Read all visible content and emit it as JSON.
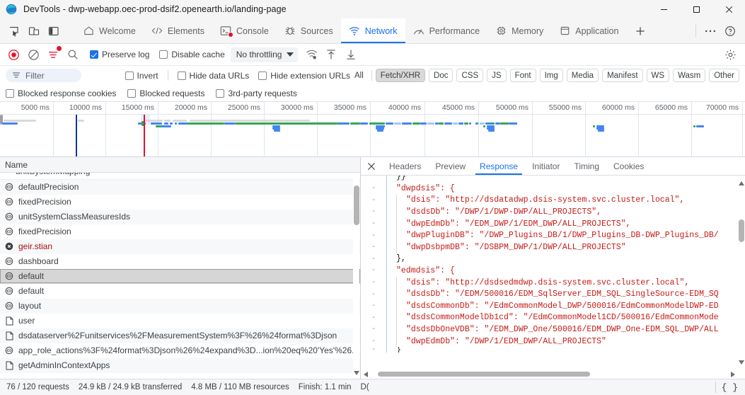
{
  "window": {
    "title": "DevTools - dwp-webapp.oec-prod-dsif2.openearth.io/landing-page",
    "minimize": "minimize-icon",
    "maximize": "maximize-icon",
    "close": "close-icon"
  },
  "tabstrip": {
    "left_icons": [
      {
        "name": "inspect-element-icon"
      },
      {
        "name": "device-toolbar-icon"
      },
      {
        "name": "dock-side-icon"
      }
    ],
    "tabs": [
      {
        "label": "Welcome",
        "icon": "home-icon",
        "active": false
      },
      {
        "label": "Elements",
        "icon": "code-brackets-icon",
        "active": false
      },
      {
        "label": "Console",
        "icon": "console-terminal-icon",
        "active": false,
        "badge": "error"
      },
      {
        "label": "Sources",
        "icon": "bug-icon",
        "active": false
      },
      {
        "label": "Network",
        "icon": "network-wifi-icon",
        "active": true
      },
      {
        "label": "Performance",
        "icon": "performance-gauge-icon",
        "active": false
      },
      {
        "label": "Memory",
        "icon": "memory-chip-icon",
        "active": false
      },
      {
        "label": "Application",
        "icon": "application-box-icon",
        "active": false
      }
    ],
    "add_tab": "+",
    "more_tools": "more-horizontal-icon",
    "help": "help-circle-icon"
  },
  "network_toolbar": {
    "record": "record-stop-icon",
    "clear": "clear-circle-slash-icon",
    "filter_toggle": "filter-lines-icon",
    "search": "search-icon",
    "preserve_log": {
      "label": "Preserve log",
      "checked": true
    },
    "disable_cache": {
      "label": "Disable cache",
      "checked": false
    },
    "throttling": {
      "value": "No throttling",
      "caret": "chevron-down-icon"
    },
    "network_conditions": "network-conditions-icon",
    "import_har": "upload-arrow-icon",
    "export_har": "download-arrow-icon",
    "settings": "gear-icon"
  },
  "filter_bar": {
    "filter_placeholder": "Filter",
    "filter_icon": "filter-icon",
    "invert": {
      "label": "Invert",
      "checked": false
    },
    "hide_data_urls": {
      "label": "Hide data URLs",
      "checked": false
    },
    "hide_extension_urls": {
      "label": "Hide extension URLs",
      "checked": false
    },
    "types": [
      {
        "label": "All",
        "selected": false
      },
      {
        "label": "Fetch/XHR",
        "selected": true
      },
      {
        "label": "Doc",
        "selected": false
      },
      {
        "label": "CSS",
        "selected": false
      },
      {
        "label": "JS",
        "selected": false
      },
      {
        "label": "Font",
        "selected": false
      },
      {
        "label": "Img",
        "selected": false
      },
      {
        "label": "Media",
        "selected": false
      },
      {
        "label": "Manifest",
        "selected": false
      },
      {
        "label": "WS",
        "selected": false
      },
      {
        "label": "Wasm",
        "selected": false
      },
      {
        "label": "Other",
        "selected": false
      }
    ],
    "row2": [
      {
        "label": "Blocked response cookies",
        "checked": false
      },
      {
        "label": "Blocked requests",
        "checked": false
      },
      {
        "label": "3rd-party requests",
        "checked": false
      }
    ]
  },
  "overview": {
    "ticks": [
      "5000 ms",
      "10000 ms",
      "15000 ms",
      "20000 ms",
      "25000 ms",
      "30000 ms",
      "35000 ms",
      "40000 ms",
      "45000 ms",
      "50000 ms",
      "55000 ms",
      "60000 ms",
      "65000 ms",
      "70000 ms"
    ],
    "dom_content_loaded_marker_ms": 10100,
    "load_marker_ms": 15100,
    "colors": {
      "dom_content_loaded": "#10398f",
      "load": "#e8102a",
      "request_blue": "#4285f4",
      "request_green": "#34a853",
      "request_grey": "#d9d9d9"
    }
  },
  "requests": {
    "column_header": "Name",
    "rows": [
      {
        "name": "defaultPrecision",
        "icon": "xhr-icon",
        "state": "normal"
      },
      {
        "name": "fixedPrecision",
        "icon": "xhr-icon",
        "state": "normal"
      },
      {
        "name": "unitSystemClassMeasuresIds",
        "icon": "xhr-icon",
        "state": "normal"
      },
      {
        "name": "fixedPrecision",
        "icon": "xhr-icon",
        "state": "normal"
      },
      {
        "name": "geir.stian",
        "icon": "error-icon",
        "state": "error"
      },
      {
        "name": "dashboard",
        "icon": "xhr-icon",
        "state": "normal"
      },
      {
        "name": "default",
        "icon": "xhr-icon",
        "state": "selected"
      },
      {
        "name": "default",
        "icon": "xhr-icon",
        "state": "normal"
      },
      {
        "name": "layout",
        "icon": "xhr-icon",
        "state": "normal"
      },
      {
        "name": "user",
        "icon": "document-icon",
        "state": "normal"
      },
      {
        "name": "dsdataserver%2Funitservices%2FMeasurementSystem%3F%26%24format%3Djson",
        "icon": "document-icon",
        "state": "normal"
      },
      {
        "name": "app_role_actions%3F%24format%3Djson%26%24expand%3D...ion%20eq%20'Yes'%26...",
        "icon": "xhr-icon",
        "state": "normal"
      },
      {
        "name": "getAdminInContextApps",
        "icon": "document-icon",
        "state": "normal"
      }
    ]
  },
  "detail": {
    "close": "close-icon",
    "tabs": [
      {
        "label": "Headers",
        "active": false
      },
      {
        "label": "Preview",
        "active": false
      },
      {
        "label": "Response",
        "active": true
      },
      {
        "label": "Initiator",
        "active": false
      },
      {
        "label": "Timing",
        "active": false
      },
      {
        "label": "Cookies",
        "active": false
      }
    ],
    "response_lines": [
      {
        "gutter": "",
        "indent": 1,
        "fold": 0,
        "text": "}}"
      },
      {
        "gutter": "-",
        "indent": 1,
        "fold": 1,
        "text": "\"dwpdsis\": {"
      },
      {
        "gutter": "-",
        "indent": 2,
        "fold": 2,
        "text": "\"dsis\": \"http://dsdatadwp.dsis-system.svc.cluster.local\","
      },
      {
        "gutter": "-",
        "indent": 2,
        "fold": 2,
        "text": "\"dsdsDb\": \"/DWP/1/DWP-DWP/ALL_PROJECTS\","
      },
      {
        "gutter": "-",
        "indent": 2,
        "fold": 2,
        "text": "\"dwpEdmDb\": \"/EDM_DWP/1/EDM_DWP/ALL_PROJECTS\","
      },
      {
        "gutter": "-",
        "indent": 2,
        "fold": 2,
        "text": "\"dwpPluginDB\": \"/DWP_Plugins_DB/1/DWP_Plugins_DB-DWP_Plugins_DB/"
      },
      {
        "gutter": "-",
        "indent": 2,
        "fold": 2,
        "text": "\"dwpDsbpmDB\": \"/DSBPM_DWP/1/DWP/ALL_PROJECTS\""
      },
      {
        "gutter": "-",
        "indent": 1,
        "fold": 1,
        "text": "},"
      },
      {
        "gutter": "-",
        "indent": 1,
        "fold": 1,
        "text": "\"edmdsis\": {"
      },
      {
        "gutter": "-",
        "indent": 2,
        "fold": 2,
        "text": "\"dsis\": \"http://dsdsedmdwp.dsis-system.svc.cluster.local\","
      },
      {
        "gutter": "-",
        "indent": 2,
        "fold": 2,
        "text": "\"dsdsDb\": \"/EDM/500016/EDM_SqlServer_EDM_SQL_SingleSource-EDM_SQ"
      },
      {
        "gutter": "-",
        "indent": 2,
        "fold": 2,
        "text": "\"dsdsCommonDb\": \"/EdmCommonModel_DWP/500016/EdmCommonModelDWP-ED"
      },
      {
        "gutter": "-",
        "indent": 2,
        "fold": 2,
        "text": "\"dsdsCommonModelDb1cd\": \"/EdmCommonModel1CD/500016/EdmCommonMode"
      },
      {
        "gutter": "-",
        "indent": 2,
        "fold": 2,
        "text": "\"dsdsDbOneVDB\": \"/EDM_DWP_One/500016/EDM_DWP_One-EDM_SQL_DWP/ALL"
      },
      {
        "gutter": "-",
        "indent": 2,
        "fold": 2,
        "text": "\"dwpEdmDb\": \"/DWP/1/EDM_DWP/ALL_PROJECTS\""
      },
      {
        "gutter": "-",
        "indent": 1,
        "fold": 1,
        "text": "}"
      }
    ],
    "scroll_left_arrow": "chevron-left-icon",
    "scroll_right_arrow": "chevron-right-icon"
  },
  "statusbar": {
    "requests": "76 / 120 requests",
    "transferred": "24.9 kB / 24.9 kB transferred",
    "resources": "4.8 MB / 110 MB resources",
    "finish": "Finish: 1.1 min",
    "truncated": "D(",
    "console_toggle": "{ }"
  }
}
